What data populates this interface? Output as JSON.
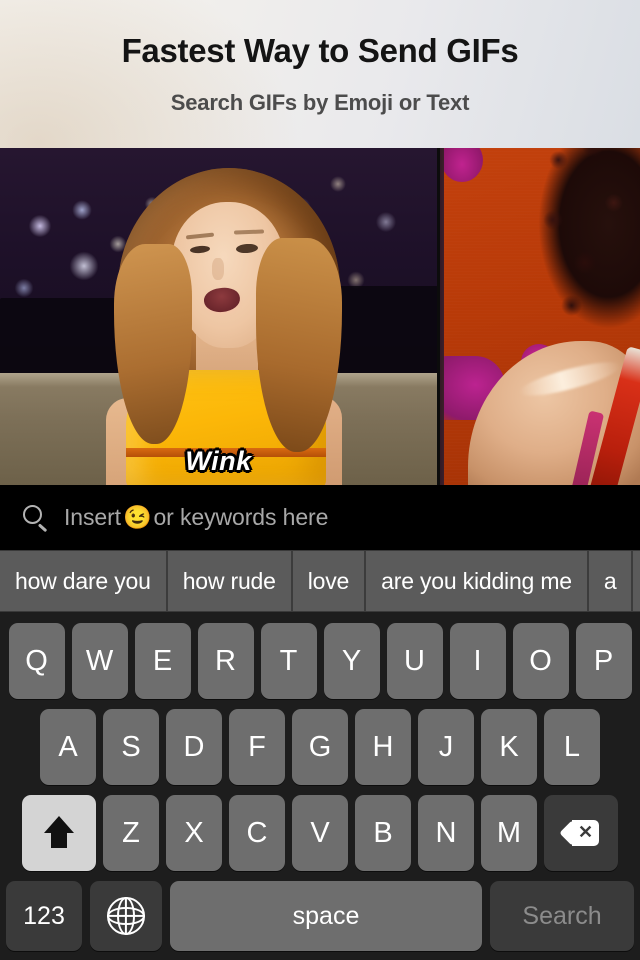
{
  "header": {
    "title": "Fastest Way to Send GIFs",
    "subtitle": "Search GIFs by Emoji or Text"
  },
  "results": {
    "items": [
      {
        "caption": "Wink",
        "description": "Woman in yellow dress on talk show set with night skyline backdrop"
      },
      {
        "caption": "",
        "description": "Bare shoulder with dark curly hair and red strap on orange background"
      }
    ]
  },
  "search": {
    "icon": "search-icon",
    "placeholder_before": "Insert",
    "placeholder_emoji": "😉",
    "placeholder_after": "or keywords here",
    "value": ""
  },
  "suggestions": [
    "how dare you",
    "how rude",
    "love",
    "are you kidding me",
    "a"
  ],
  "keyboard": {
    "row1": [
      "Q",
      "W",
      "E",
      "R",
      "T",
      "Y",
      "U",
      "I",
      "O",
      "P"
    ],
    "row2": [
      "A",
      "S",
      "D",
      "F",
      "G",
      "H",
      "J",
      "K",
      "L"
    ],
    "row3": [
      "Z",
      "X",
      "C",
      "V",
      "B",
      "N",
      "M"
    ],
    "shift_label": "shift-key",
    "backspace_label": "backspace-key",
    "numbers_label": "123",
    "globe_label": "globe-key",
    "space_label": "space",
    "search_label": "Search"
  },
  "colors": {
    "keyboard_bg": "#1d1d1d",
    "key_bg": "#6e6e6e",
    "key_dark": "#3a3a3a",
    "shift_active": "#d4d4d4",
    "suggestion_bg": "#5b5b5b",
    "search_bar_bg": "#000000",
    "search_placeholder": "#a8a8a8",
    "search_key_text": "#8c8c8c",
    "header_text": "#141414",
    "header_subtext": "#4c4c4c"
  }
}
